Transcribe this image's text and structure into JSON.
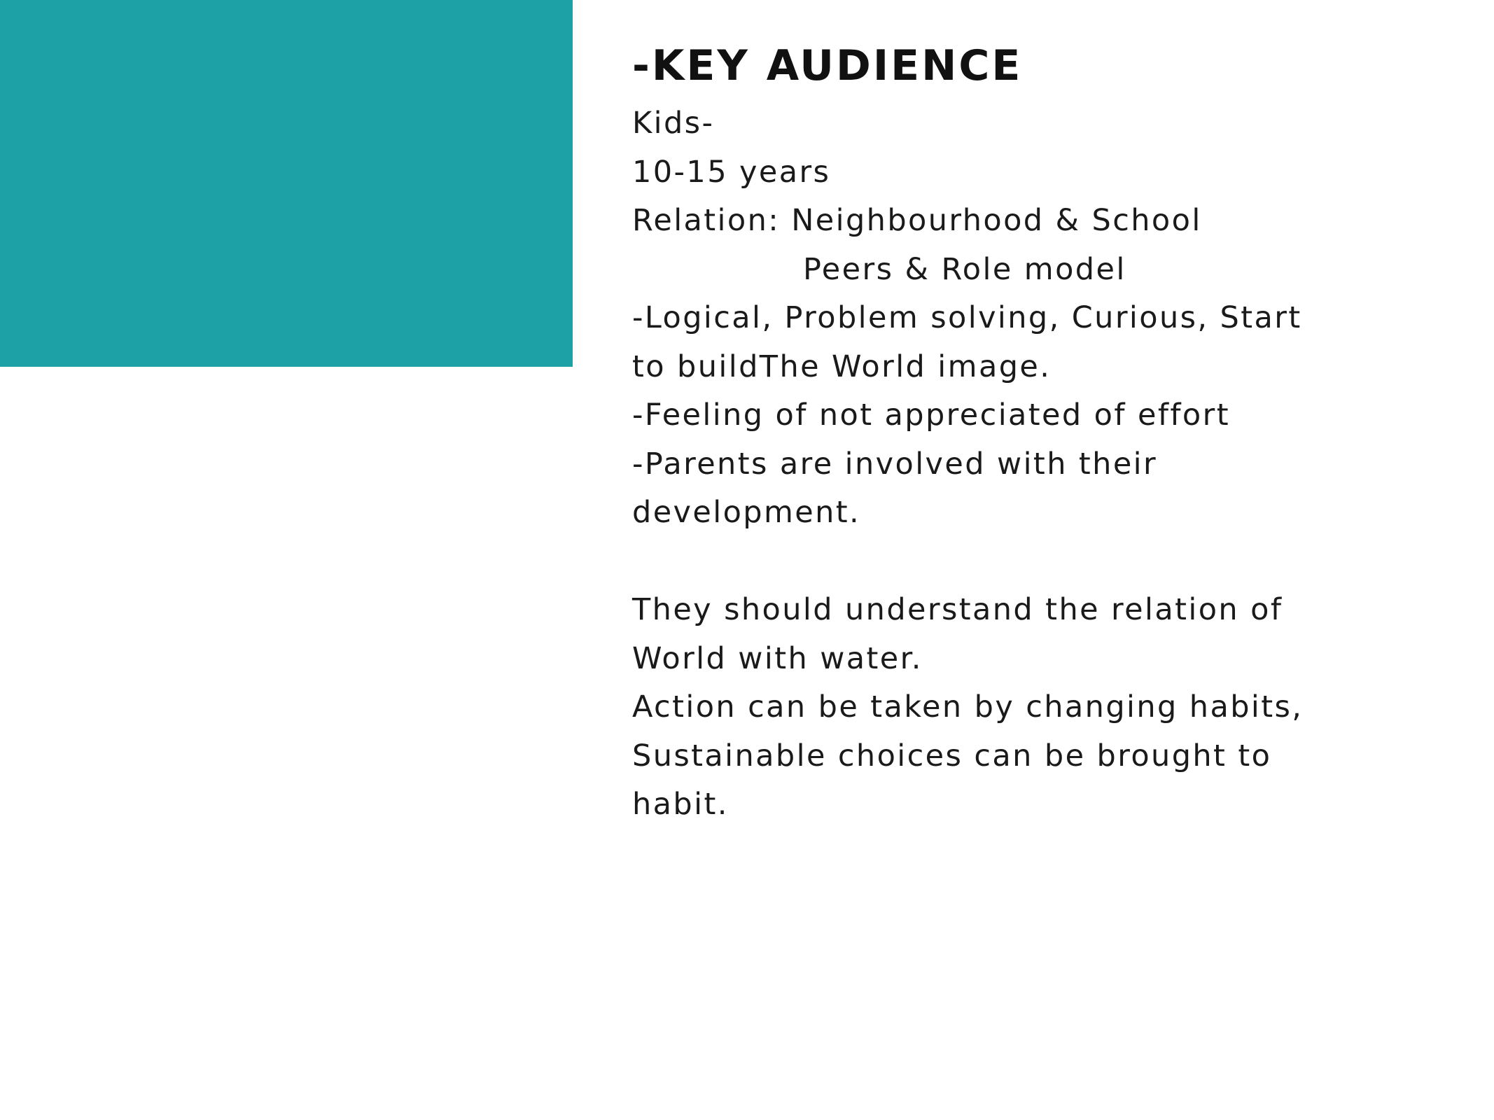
{
  "colors": {
    "accent": "#1ea1a6",
    "text": "#111111",
    "background": "#ffffff"
  },
  "slide": {
    "title": "-KEY AUDIENCE",
    "lines": [
      "Kids-",
      "10-15 years",
      "Relation: Neighbourhood & School",
      "Peers & Role model",
      "-Logical, Problem solving, Curious, Start",
      "to buildThe World image.",
      "-Feeling of not appreciated of effort",
      "-Parents are involved with their",
      "development.",
      "",
      "They should understand the relation of",
      "World with water.",
      "Action can be taken by changing habits,",
      "Sustainable choices can be brought to",
      "habit."
    ]
  }
}
